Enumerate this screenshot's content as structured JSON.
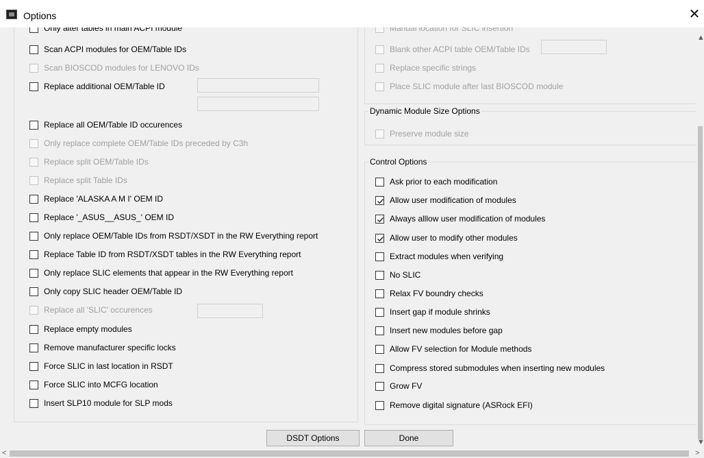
{
  "window": {
    "title": "Options",
    "close_glyph": "✕"
  },
  "left_options": [
    {
      "label": "Only alter tables in main ACPI module",
      "checked": false,
      "disabled": false
    },
    {
      "label": "Scan ACPI modules for OEM/Table IDs",
      "checked": false,
      "disabled": false
    },
    {
      "label": "Scan BIOSCOD modules for LENOVO IDs",
      "checked": false,
      "disabled": true
    },
    {
      "label": "Replace additional OEM/Table ID",
      "checked": false,
      "disabled": false
    },
    {
      "label": "Replace all OEM/Table ID occurences",
      "checked": false,
      "disabled": false
    },
    {
      "label": "Only replace complete OEM/Table IDs preceded by C3h",
      "checked": false,
      "disabled": true
    },
    {
      "label": "Replace split OEM/Table IDs",
      "checked": false,
      "disabled": true
    },
    {
      "label": "Replace split Table IDs",
      "checked": false,
      "disabled": true
    },
    {
      "label": "Replace 'ALASKA A M I' OEM ID",
      "checked": false,
      "disabled": false
    },
    {
      "label": "Replace '_ASUS__ASUS_' OEM ID",
      "checked": false,
      "disabled": false
    },
    {
      "label": "Only replace OEM/Table IDs from RSDT/XSDT in the RW Everything report",
      "checked": false,
      "disabled": false
    },
    {
      "label": "Replace Table ID from RSDT/XSDT tables in the RW Everything report",
      "checked": false,
      "disabled": false
    },
    {
      "label": "Only replace SLIC elements that appear in the RW Everything report",
      "checked": false,
      "disabled": false
    },
    {
      "label": "Only copy SLIC header OEM/Table ID",
      "checked": false,
      "disabled": false
    },
    {
      "label": "Replace all 'SLIC' occurences",
      "checked": false,
      "disabled": true
    },
    {
      "label": "Replace empty modules",
      "checked": false,
      "disabled": false
    },
    {
      "label": "Remove manufacturer specific locks",
      "checked": false,
      "disabled": false
    },
    {
      "label": "Force SLIC in last location in RSDT",
      "checked": false,
      "disabled": false
    },
    {
      "label": "Force SLIC into MCFG location",
      "checked": false,
      "disabled": false
    },
    {
      "label": "Insert SLP10 module for SLP mods",
      "checked": false,
      "disabled": false
    }
  ],
  "right_top_options": [
    {
      "label": "Manual location for SLIC insertion",
      "checked": false,
      "disabled": true
    },
    {
      "label": "Blank other ACPI table OEM/Table IDs",
      "checked": false,
      "disabled": true
    },
    {
      "label": "Replace specific strings",
      "checked": false,
      "disabled": true
    },
    {
      "label": "Place SLIC module after last BIOSCOD module",
      "checked": false,
      "disabled": true
    }
  ],
  "dynamic_group": {
    "title": "Dynamic Module Size Options",
    "options": [
      {
        "label": "Preserve module size",
        "checked": false,
        "disabled": true
      }
    ]
  },
  "control_group": {
    "title": "Control Options",
    "options": [
      {
        "label": "Ask prior to each modification",
        "checked": false,
        "disabled": false
      },
      {
        "label": "Allow user modification of modules",
        "checked": true,
        "disabled": false
      },
      {
        "label": "Always alllow user modification of modules",
        "checked": true,
        "disabled": false
      },
      {
        "label": "Allow user to modify other modules",
        "checked": true,
        "disabled": false
      },
      {
        "label": "Extract modules when verifying",
        "checked": false,
        "disabled": false
      },
      {
        "label": "No SLIC",
        "checked": false,
        "disabled": false
      },
      {
        "label": "Relax FV boundry checks",
        "checked": false,
        "disabled": false
      },
      {
        "label": "Insert gap if module shrinks",
        "checked": false,
        "disabled": false
      },
      {
        "label": "Insert new modules before gap",
        "checked": false,
        "disabled": false
      },
      {
        "label": "Allow FV selection for Module methods",
        "checked": false,
        "disabled": false
      },
      {
        "label": "Compress stored submodules when inserting new modules",
        "checked": false,
        "disabled": false
      },
      {
        "label": "Grow FV",
        "checked": false,
        "disabled": false
      },
      {
        "label": "Remove digital signature (ASRock EFI)",
        "checked": false,
        "disabled": false
      }
    ]
  },
  "buttons": {
    "dsdt": "DSDT Options",
    "done": "Done"
  },
  "scroll_glyphs": {
    "up": "▲",
    "down": "▼",
    "left": "<",
    "right": ">"
  }
}
